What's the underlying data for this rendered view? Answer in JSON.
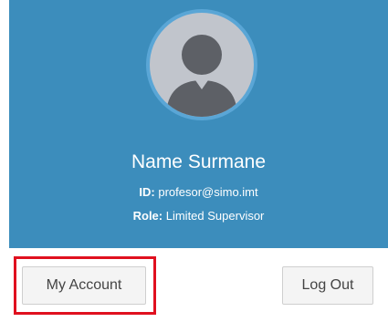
{
  "user": {
    "name": "Name Surmane",
    "id_label": "ID:",
    "id_value": "profesor@simo.imt",
    "role_label": "Role:",
    "role_value": "Limited Supervisor"
  },
  "footer": {
    "account_label": "My Account",
    "logout_label": "Log Out"
  },
  "icons": {
    "avatar": "user-silhouette-icon"
  },
  "colors": {
    "header_bg": "#3c8dbc",
    "highlight": "#e0101f",
    "avatar_bg": "#c1c5cc",
    "avatar_figure": "#5d6066"
  }
}
